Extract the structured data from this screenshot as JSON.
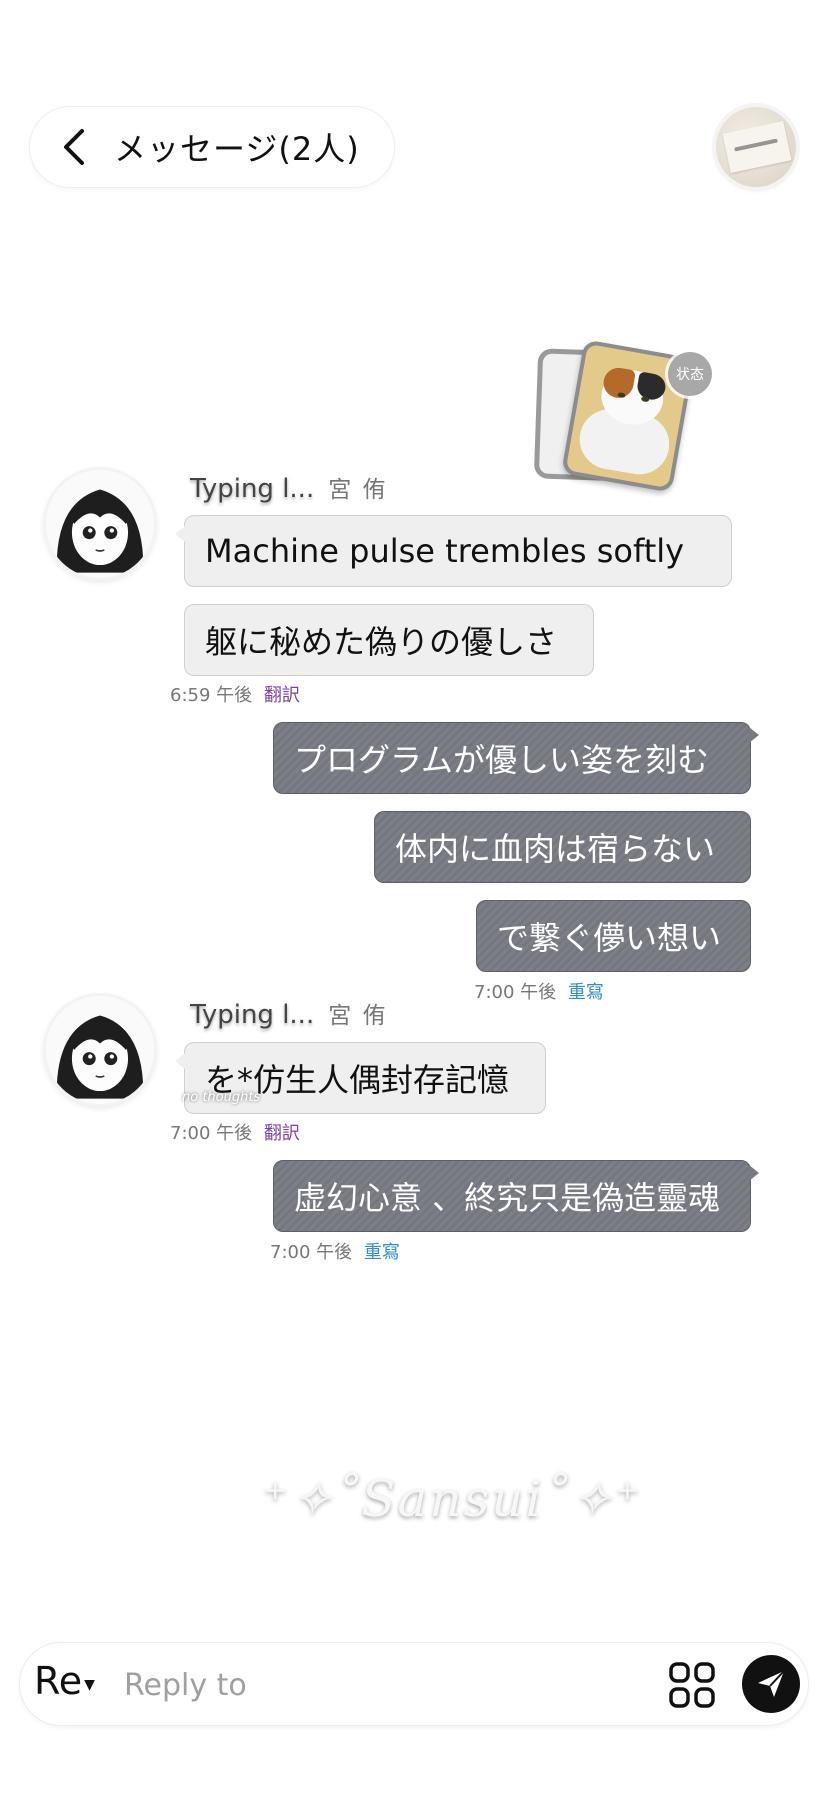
{
  "header": {
    "title": "メッセージ(2人)",
    "back_icon": "chevron-left-icon"
  },
  "status_card": {
    "label": "状态"
  },
  "messages": [
    {
      "type": "sender",
      "typing": "Typing l...",
      "name": "宮 侑"
    },
    {
      "type": "in",
      "text": "Machine pulse trembles softly"
    },
    {
      "type": "in",
      "text": "躯に秘めた偽りの優しさ"
    },
    {
      "type": "meta",
      "time": "6:59 午後",
      "action": "翻訳"
    },
    {
      "type": "out",
      "text": "プログラムが優しい姿を刻む"
    },
    {
      "type": "out",
      "text": "体内に血肉は宿らない"
    },
    {
      "type": "out",
      "text": "で繋ぐ儚い想い"
    },
    {
      "type": "meta",
      "time": "7:00 午後",
      "action": "重寫"
    },
    {
      "type": "sender",
      "typing": "Typing l...",
      "name": "宮 侑"
    },
    {
      "type": "in",
      "text": "を*仿生人偶封存記憶"
    },
    {
      "type": "meta",
      "time": "7:00 午後",
      "action": "翻訳"
    },
    {
      "type": "out",
      "text": "虚幻心意 、終究只是偽造靈魂"
    },
    {
      "type": "meta",
      "time": "7:00 午後",
      "action": "重寫"
    }
  ],
  "overlay_note": "no thoughts",
  "watermark": "⁺✧˚Sansui˚✧⁺",
  "composer": {
    "mode_label": "Re",
    "placeholder": "Reply to",
    "apps_icon": "apps-grid-icon",
    "send_icon": "send-icon"
  },
  "colors": {
    "outgoing_bubble": "#7a7c84",
    "incoming_bubble": "#efefef",
    "translate_link": "#7b3fa8",
    "rewrite_link": "#2e8fd6"
  }
}
